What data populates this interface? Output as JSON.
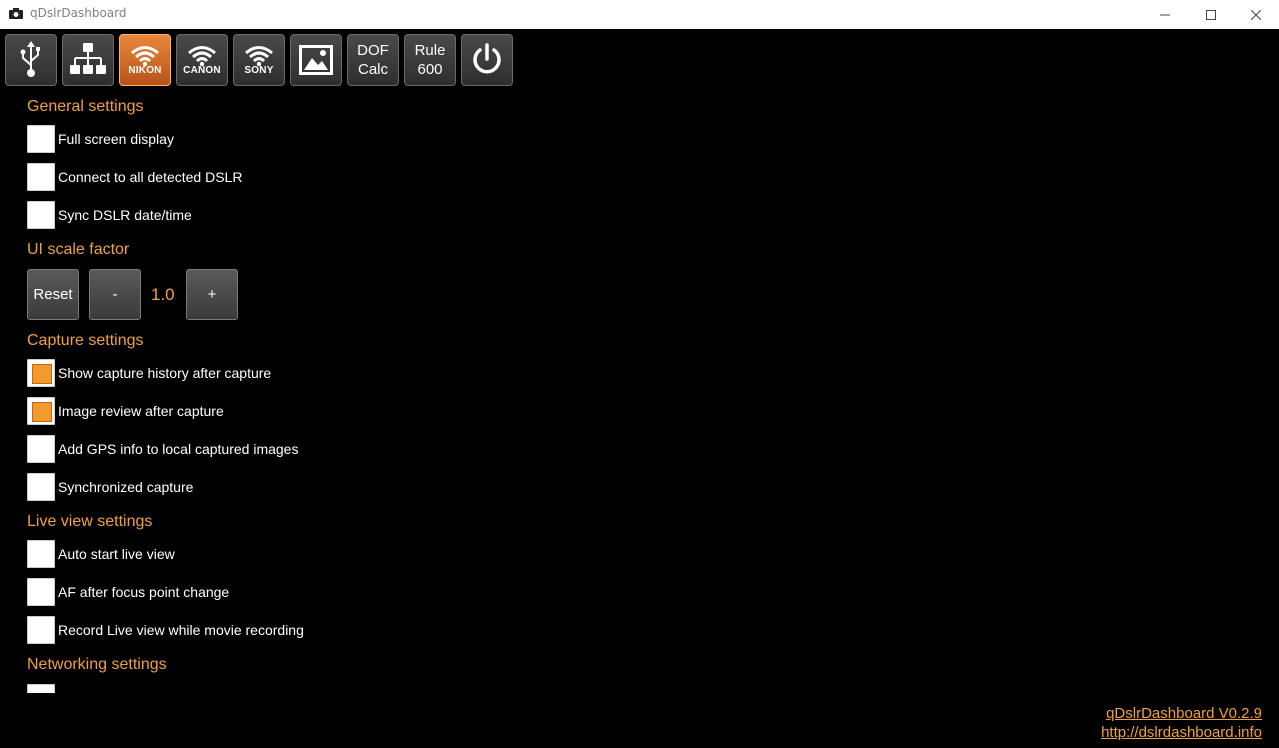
{
  "window": {
    "title": "qDslrDashboard",
    "app_icon": "camera-icon"
  },
  "toolbar": {
    "usb": {
      "icon": "usb-icon"
    },
    "network": {
      "icon": "network-icon"
    },
    "nikon": {
      "icon": "wifi-icon",
      "label": "NIKON",
      "active": true
    },
    "canon": {
      "icon": "wifi-icon",
      "label": "CANON"
    },
    "sony": {
      "icon": "wifi-icon",
      "label": "SONY"
    },
    "gallery": {
      "icon": "image-icon"
    },
    "dof": {
      "line1": "DOF",
      "line2": "Calc"
    },
    "rule600": {
      "line1": "Rule",
      "line2": "600"
    },
    "power": {
      "icon": "power-icon"
    }
  },
  "general": {
    "heading": "General settings",
    "items": [
      {
        "label": "Full screen display",
        "checked": false
      },
      {
        "label": "Connect to all detected DSLR",
        "checked": false
      },
      {
        "label": "Sync DSLR date/time",
        "checked": false
      }
    ]
  },
  "scale": {
    "heading": "UI scale factor",
    "reset_label": "Reset",
    "minus_label": "-",
    "plus_label": "+",
    "value": "1.0"
  },
  "capture": {
    "heading": "Capture settings",
    "items": [
      {
        "label": "Show capture history after capture",
        "checked": true
      },
      {
        "label": "Image review after capture",
        "checked": true
      },
      {
        "label": "Add GPS info to local captured images",
        "checked": false
      },
      {
        "label": "Synchronized capture",
        "checked": false
      }
    ]
  },
  "liveview": {
    "heading": "Live view settings",
    "items": [
      {
        "label": "Auto start live view",
        "checked": false
      },
      {
        "label": "AF after focus point change",
        "checked": false
      },
      {
        "label": "Record Live view while movie recording",
        "checked": false
      }
    ]
  },
  "networking": {
    "heading": "Networking settings"
  },
  "footer": {
    "version": "qDslrDashboard V0.2.9",
    "url": "http://dslrdashboard.info"
  },
  "colors": {
    "accent": "#f0a040",
    "checked_fill": "#f39a2e",
    "active_button": "#d0702a",
    "background": "#000000"
  }
}
